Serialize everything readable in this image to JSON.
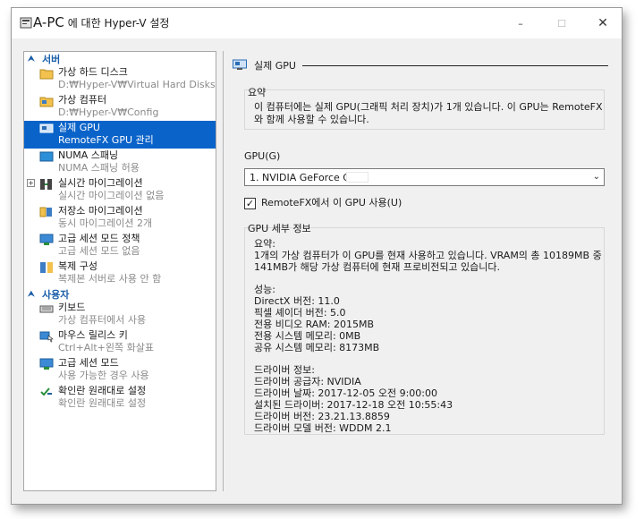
{
  "window": {
    "title_prefix": "A-PC",
    "title_suffix": " 에 대한 Hyper-V 설정",
    "minimize": "–",
    "maximize": "☐",
    "close": "✕"
  },
  "sidebar": {
    "server_section": "서버",
    "user_section": "사용자",
    "server_items": [
      {
        "title": "가상 하드 디스크",
        "sub": "D:₩Hyper-V₩Virtual Hard Disks"
      },
      {
        "title": "가상 컴퓨터",
        "sub": "D:₩Hyper-V₩Config"
      },
      {
        "title": "실제 GPU",
        "sub": "RemoteFX GPU 관리"
      },
      {
        "title": "NUMA 스패닝",
        "sub": "NUMA 스패닝 허용"
      },
      {
        "title": "실시간 마이그레이션",
        "sub": "실시간 마이그레이션 없음"
      },
      {
        "title": "저장소 마이그레이션",
        "sub": "동시 마이그레이션 2개"
      },
      {
        "title": "고급 세션 모드 정책",
        "sub": "고급 세션 모드 없음"
      },
      {
        "title": "복제 구성",
        "sub": "복제본 서버로 사용 안 함"
      }
    ],
    "user_items": [
      {
        "title": "키보드",
        "sub": "가상 컴퓨터에서 사용"
      },
      {
        "title": "마우스 릴리스 키",
        "sub": "Ctrl+Alt+왼쪽 화살표"
      },
      {
        "title": "고급 세션 모드",
        "sub": "사용 가능한 경우 사용"
      },
      {
        "title": "확인란 원래대로 설정",
        "sub": "확인란 원래대로 설정"
      }
    ]
  },
  "panel": {
    "header": "실제 GPU",
    "summary_label": "요약",
    "summary_line1": "이 컴퓨터에는 실제 GPU(그래픽 처리 장치)가 1개 있습니다. 이 GPU는 RemoteFX",
    "summary_line2": "와 함께 사용할 수 있습니다.",
    "gpu_label": "GPU(G)",
    "gpu_selected": "1. NVIDIA GeForce GTX",
    "remotefx_checkbox": "RemoteFX에서 이 GPU 사용(U)",
    "remotefx_checked": true,
    "details_label": "GPU 세부 정보",
    "details_summary_title": "요약:",
    "details_summary_line1": "1개의 가상 컴퓨터가 이 GPU를 현재 사용하고 있습니다. VRAM의 총 10189MB 중",
    "details_summary_line2": "141MB가 해당 가상 컴퓨터에 현재 프로비전되고 있습니다.",
    "performance_title": "성능:",
    "performance": [
      "DirectX 버전: 11.0",
      "픽셀 셰이더 버전: 5.0",
      "전용 비디오 RAM: 2015MB",
      "전용 시스템 메모리: 0MB",
      "공유 시스템 메모리: 8173MB"
    ],
    "driver_title": "드라이버 정보:",
    "driver": [
      "드라이버 공급자: NVIDIA",
      "드라이버 날짜: 2017-12-05 오전 9:00:00",
      "설치된 드라이버: 2017-12-18 오전 10:55:43",
      "드라이버 버전: 23.21.13.8859",
      "드라이버 모델 버전: WDDM 2.1"
    ]
  },
  "colors": {
    "selection": "#0a63c9",
    "section_blue": "#1a5ea8"
  }
}
